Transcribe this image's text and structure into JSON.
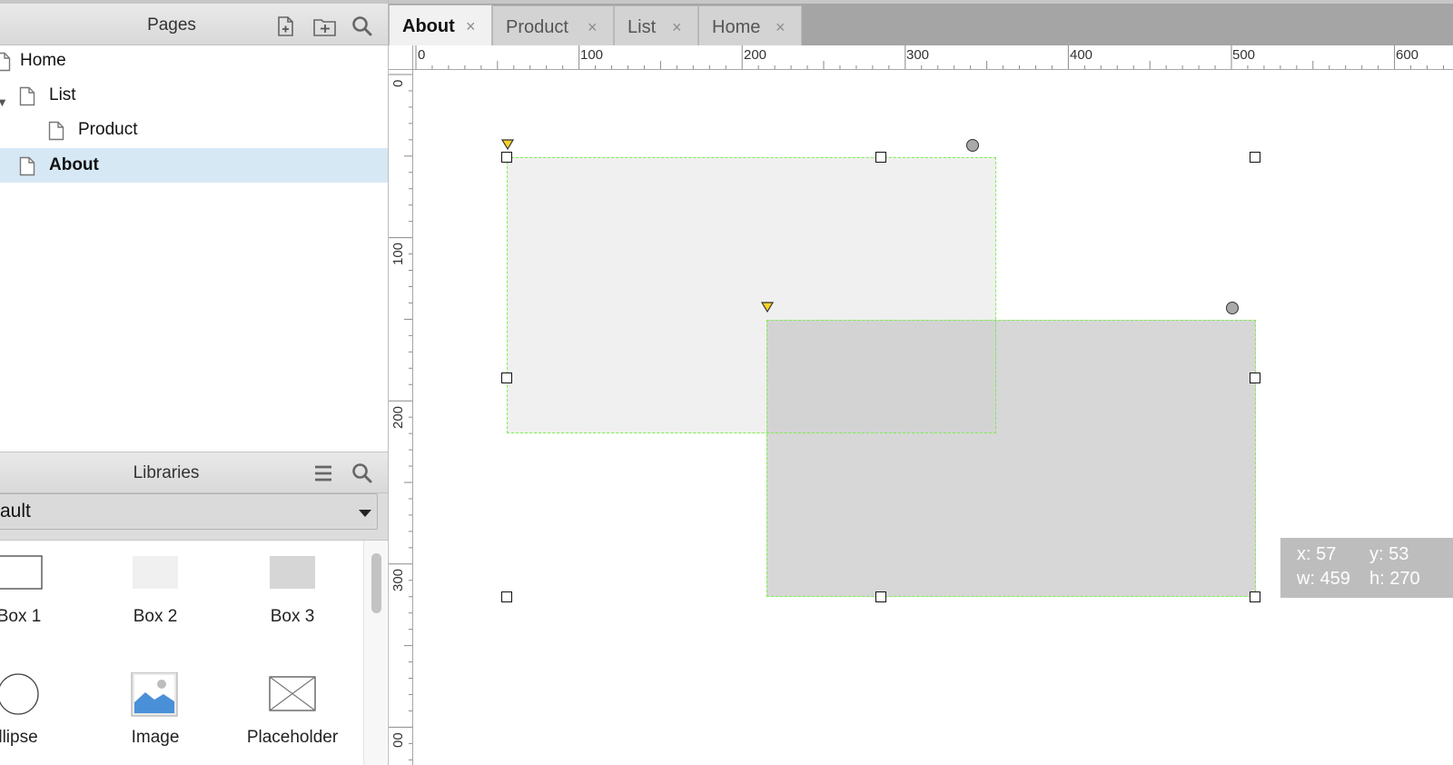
{
  "pages_panel": {
    "title": "Pages",
    "icons": [
      "add-page-icon",
      "add-folder-icon",
      "search-icon"
    ],
    "tree": [
      {
        "label": "Home",
        "depth": 0,
        "selected": false
      },
      {
        "label": "List",
        "depth": 0,
        "expanded": true,
        "selected": false
      },
      {
        "label": "Product",
        "depth": 1,
        "selected": false
      },
      {
        "label": "About",
        "depth": 0,
        "selected": true
      }
    ]
  },
  "libraries_panel": {
    "title": "Libraries",
    "icons": [
      "menu-icon",
      "search-icon"
    ],
    "selected_library": "ault",
    "items": [
      {
        "label": "Box 1",
        "icon": "box-outline-icon"
      },
      {
        "label": "Box 2",
        "icon": "box-light-icon"
      },
      {
        "label": "Box 3",
        "icon": "box-gray-icon"
      },
      {
        "label": "Ellipse",
        "display": "llipse",
        "icon": "ellipse-icon"
      },
      {
        "label": "Image",
        "icon": "image-icon"
      },
      {
        "label": "Placeholder",
        "icon": "placeholder-icon"
      }
    ],
    "box1_display": "Box 1"
  },
  "tabs": [
    {
      "label": "About",
      "active": true
    },
    {
      "label": "Product",
      "active": false
    },
    {
      "label": "List",
      "active": false
    },
    {
      "label": "Home",
      "active": false
    }
  ],
  "tab_close_glyph": "×",
  "ruler_top": {
    "labels": [
      "0",
      "100",
      "200",
      "300",
      "400",
      "500",
      "600"
    ]
  },
  "ruler_left": {
    "labels": [
      "0",
      "100",
      "200",
      "300",
      "00"
    ]
  },
  "info_box": {
    "x": "x: 57",
    "y": "y: 53",
    "w": "w: 459",
    "h": "h: 270"
  },
  "colors": {
    "selection": "#7cf04c",
    "box2_fill": "#f0f0f0",
    "box3_fill": "#d6d6d6",
    "selected_row": "#d7e8f5",
    "image_blue": "#4a90d9"
  }
}
